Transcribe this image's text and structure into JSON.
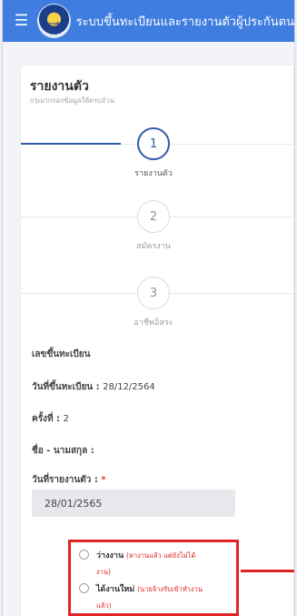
{
  "header": {
    "title": "ระบบขึ้นทะเบียนและรายงานตัวผู้ประกันตน",
    "logo_text": "กรมการจัดหางาน",
    "menu_icon": "hamburger-menu-icon",
    "bg_color": "#3f7de0"
  },
  "card": {
    "title": "รายงานตัว",
    "subtitle": "กรุณากรอกข้อมูลให้ครบถ้วน"
  },
  "steps": [
    {
      "number": "1",
      "label": "รายงานตัว",
      "active": true
    },
    {
      "number": "2",
      "label": "สมัครงาน",
      "active": false
    },
    {
      "number": "3",
      "label": "อาชีพอิสระ",
      "active": false
    }
  ],
  "fields": {
    "registration_no_label": "เลขขึ้นทะเบียน",
    "registration_date_label": "วันที่ขึ้นทะเบียน :",
    "registration_date_value": "28/12/2564",
    "round_label": "ครั้งที่ :",
    "round_value": "2",
    "name_label": "ชื่อ - นามสกุล :",
    "report_date_label": "วันที่รายงานตัว :",
    "report_date_required": "*",
    "report_date_value": "28/01/2565"
  },
  "options": [
    {
      "label": "ว่างงาน",
      "hint_line1": "(หางานแล้ว แต่ยังไม่ได้",
      "hint_line2": "งาน)"
    },
    {
      "label": "ได้งานใหม่",
      "hint_line1": "(นายจ้างรับเข้าทำงาน",
      "hint_line2": "แล้ว)"
    }
  ],
  "colors": {
    "accent": "#2e5aa8",
    "highlight": "#e02424"
  }
}
